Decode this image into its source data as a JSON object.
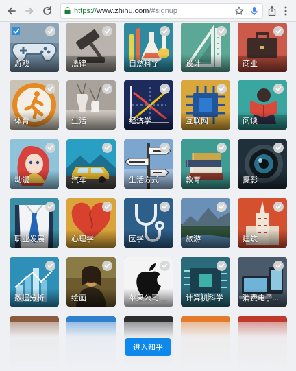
{
  "browser": {
    "url_scheme": "https://",
    "url_host": "www.zhihu.com",
    "url_path": "/#signup"
  },
  "colors": {
    "primary_button": "#0f88eb",
    "check_badge": "#d7d7d7"
  },
  "topics": [
    {
      "label": "游戏",
      "icon": "gamepad-image"
    },
    {
      "label": "法律",
      "icon": "gavel-image"
    },
    {
      "label": "自然科学",
      "icon": "lab-flask-image"
    },
    {
      "label": "设计",
      "icon": "drafting-tools-image"
    },
    {
      "label": "商业",
      "icon": "briefcase-image"
    },
    {
      "label": "体育",
      "icon": "runner-sign-image"
    },
    {
      "label": "生活",
      "icon": "vases-image"
    },
    {
      "label": "经济学",
      "icon": "supply-demand-chart-image"
    },
    {
      "label": "互联网",
      "icon": "network-chip-image"
    },
    {
      "label": "阅读",
      "icon": "person-reading-image"
    },
    {
      "label": "动漫",
      "icon": "anime-character-image"
    },
    {
      "label": "汽车",
      "icon": "car-image"
    },
    {
      "label": "生活方式",
      "icon": "street-signs-image"
    },
    {
      "label": "教育",
      "icon": "book-stack-image"
    },
    {
      "label": "摄影",
      "icon": "camera-lens-image"
    },
    {
      "label": "职业发展",
      "icon": "shirt-tie-image"
    },
    {
      "label": "心理学",
      "icon": "heart-image"
    },
    {
      "label": "医学",
      "icon": "stethoscope-image"
    },
    {
      "label": "旅游",
      "icon": "landscape-image"
    },
    {
      "label": "建筑",
      "icon": "building-image"
    },
    {
      "label": "数据分析",
      "icon": "bar-chart-image"
    },
    {
      "label": "绘画",
      "icon": "mona-lisa-image"
    },
    {
      "label": "苹果公司 ...",
      "icon": "apple-logo-image"
    },
    {
      "label": "计算机科学",
      "icon": "circuit-board-image"
    },
    {
      "label": "消费电子...",
      "icon": "electronics-image"
    },
    {
      "label": "",
      "icon": "partial-image"
    },
    {
      "label": "",
      "icon": "partial-image"
    },
    {
      "label": "",
      "icon": "partial-image"
    },
    {
      "label": "",
      "icon": "partial-image"
    },
    {
      "label": "",
      "icon": "partial-image"
    }
  ],
  "enter_button_label": "进入知乎"
}
